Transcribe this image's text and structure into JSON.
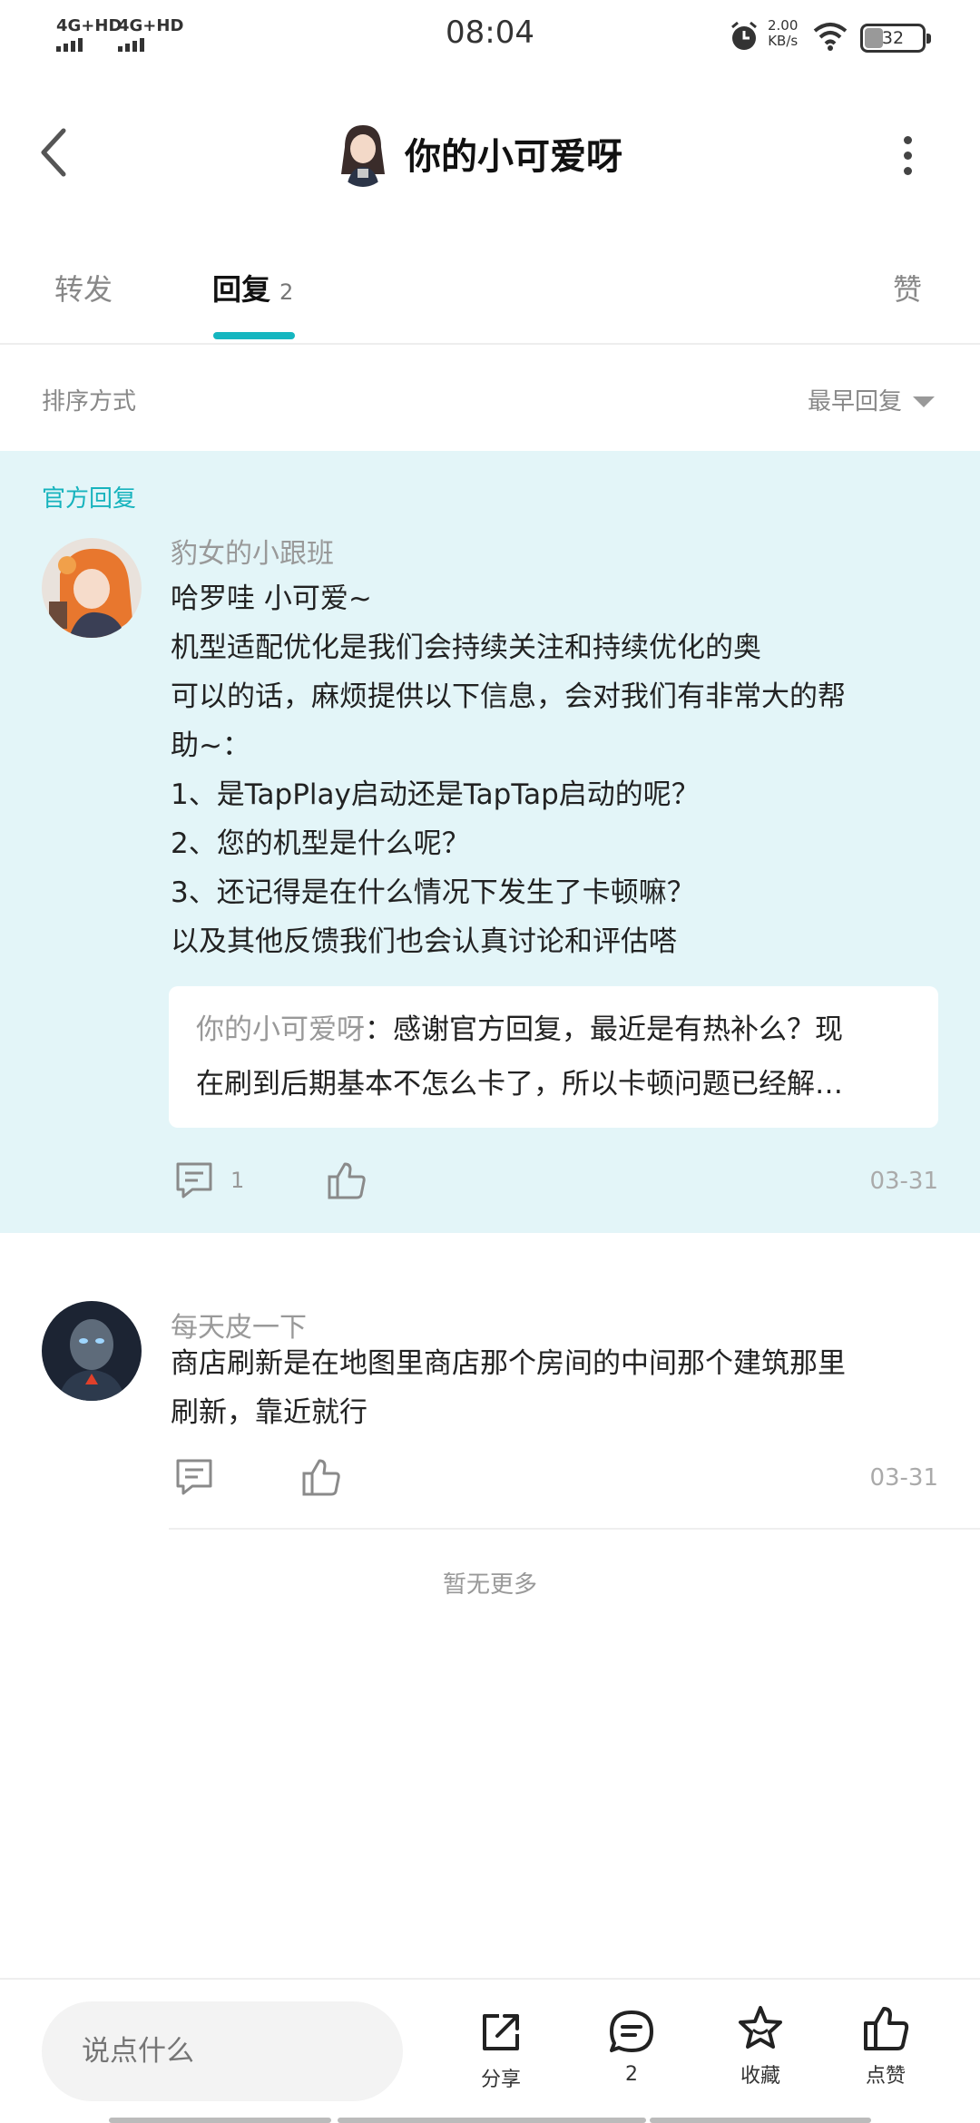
{
  "status_bar": {
    "signal_1": "4G+HD",
    "signal_2": "4G+HD",
    "time": "08:04",
    "net_speed_value": "2.00",
    "net_speed_unit": "KB/s",
    "battery": "32"
  },
  "header": {
    "title": "你的小可爱呀"
  },
  "tabs": [
    {
      "label": "转发"
    },
    {
      "label": "回复",
      "count": "2"
    },
    {
      "label": "赞"
    }
  ],
  "sort": {
    "label": "排序方式",
    "selected": "最早回复"
  },
  "official_reply": {
    "badge": "官方回复",
    "username": "豹女的小跟班",
    "lines": [
      "哈罗哇 小可爱~",
      "机型适配优化是我们会持续关注和持续优化的奥",
      "可以的话，麻烦提供以下信息，会对我们有非常大的帮",
      "助~：",
      "1、是TapPlay启动还是TapTap启动的呢？",
      "2、您的机型是什么呢？",
      "3、还记得是在什么情况下发生了卡顿嘛？",
      "以及其他反馈我们也会认真讨论和评估嗒"
    ],
    "quote": {
      "user": "你的小可爱呀",
      "line1": "：感谢官方回复，最近是有热补么？现",
      "line2": "在刷到后期基本不怎么卡了，所以卡顿问题已经解…"
    },
    "comment_count": "1",
    "date": "03-31"
  },
  "reply_2": {
    "username": "每天皮一下",
    "lines": [
      "商店刷新是在地图里商店那个房间的中间那个建筑那里",
      "刷新，靠近就行"
    ],
    "date": "03-31"
  },
  "no_more": "暂无更多",
  "bottom_bar": {
    "input_placeholder": "说点什么",
    "share": "分享",
    "comments": "2",
    "favorite": "收藏",
    "like": "点赞"
  },
  "colors": {
    "accent": "#15b6c0",
    "official_bg": "#e3f5f8"
  }
}
